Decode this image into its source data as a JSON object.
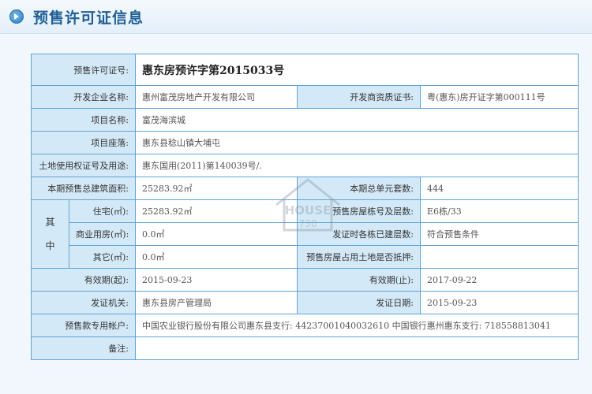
{
  "header": {
    "title": "预售许可证信息",
    "icon": "play-circle-icon"
  },
  "permit": {
    "permit_no_label": "预售许可证号:",
    "permit_no": "惠东房预许字第2015033号",
    "developer_label": "开发企业名称:",
    "developer": "惠州富茂房地产开发有限公司",
    "qual_cert_label": "开发商资质证书:",
    "qual_cert": "粤(惠东)房开证字第000111号",
    "project_label": "项目名称:",
    "project": "富茂海滨城",
    "location_label": "项目座落:",
    "location": "惠东县稔山镇大埔屯",
    "land_cert_label": "土地使用权证号及用途:",
    "land_cert": "惠东国用(2011)第140039号/.",
    "total_area_label": "本期预售总建筑面积:",
    "total_area": "25283.92㎡",
    "total_units_label": "本期总单元套数:",
    "total_units": "444",
    "breakdown_label": "其中",
    "residential_label": "住宅(㎡):",
    "residential": "25283.92㎡",
    "building_label": "预售房屋栋号及层数:",
    "building": "E6栋/33",
    "commercial_label": "商业用房(㎡):",
    "commercial": "0.0㎡",
    "built_floors_label": "发证时各栋已建层数:",
    "built_floors": "符合预售条件",
    "other_label": "其它(㎡):",
    "other": "0.0㎡",
    "mortgage_label": "预售房屋占用土地是否抵押:",
    "mortgage": "",
    "valid_from_label": "有效期(起):",
    "valid_from": "2015-09-23",
    "valid_to_label": "有效期(止):",
    "valid_to": "2017-09-22",
    "authority_label": "发证机关:",
    "authority": "惠东县房产管理局",
    "issue_date_label": "发证日期:",
    "issue_date": "2015-09-23",
    "account_label": "预售款专用帐户:",
    "account": "中国农业银行股份有限公司惠东县支行: 44237001040032610 中国银行惠州惠东支行: 718558813041",
    "remarks_label": "备注:",
    "remarks": ""
  },
  "watermark": {
    "line1": "HOUSE",
    "line2": "730",
    "icon": "house-logo-icon"
  },
  "colors": {
    "header_title": "#1f5f96",
    "table_border": "#5fa4d6",
    "label_bg": "#d4e9f7",
    "panel_bg": "#f1f7fc"
  }
}
